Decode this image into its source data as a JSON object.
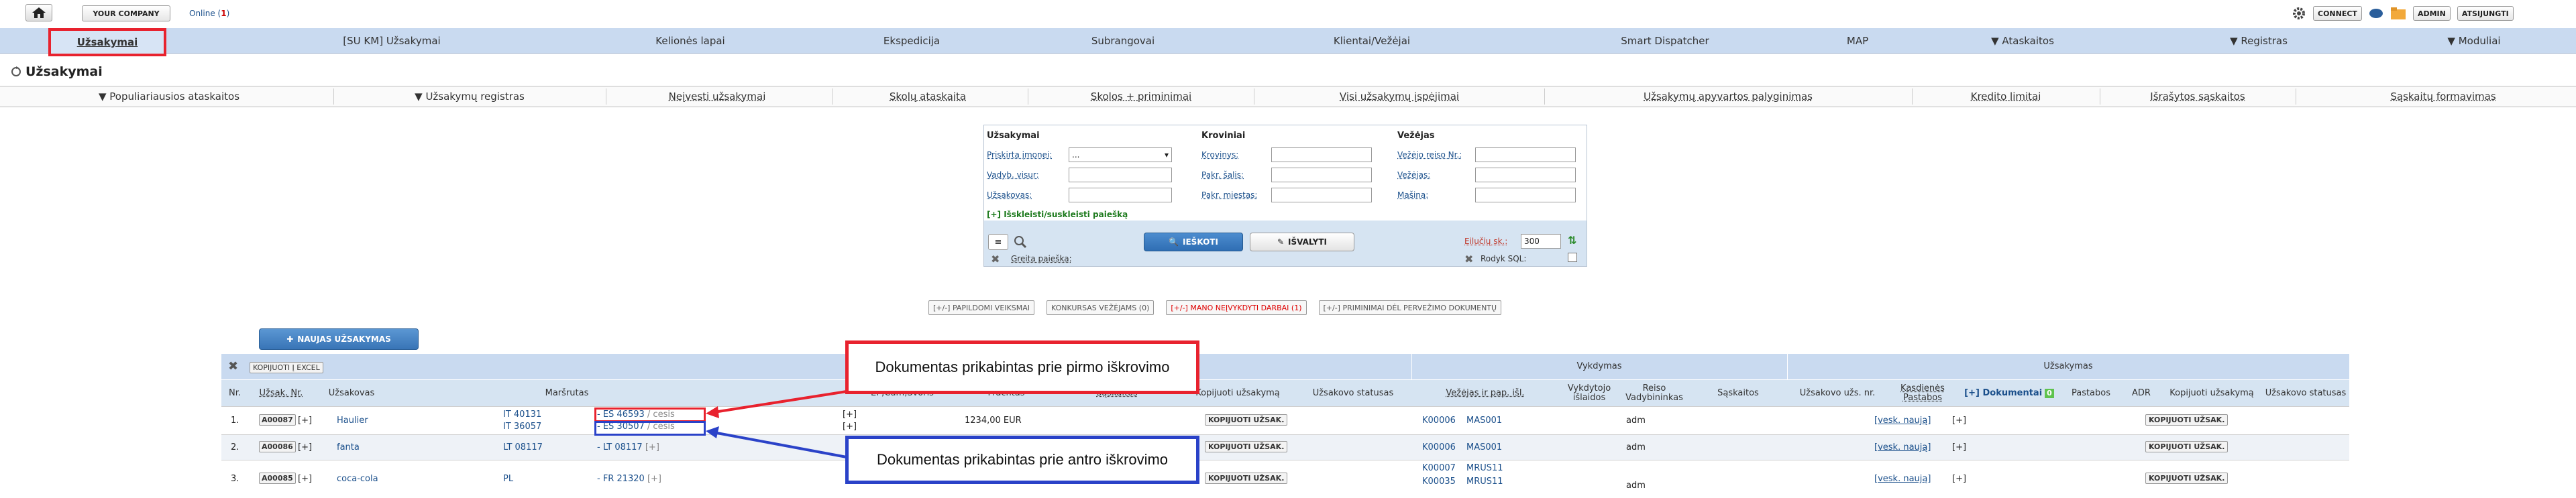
{
  "topbar": {
    "company_label": "YOUR COMPANY",
    "online_label": "Online",
    "online_count": "1",
    "connect_label": "CONNECT",
    "admin_label": "ADMIN",
    "logout_label": "ATSIJUNGTI"
  },
  "nav1": {
    "items": [
      "Užsakymai",
      "[SU KM] Užsakymai",
      "Kelionės lapai",
      "Ekspedicija",
      "Subrangovai",
      "Klientai/Vežėjai",
      "Smart Dispatcher",
      "MAP",
      "▼ Ataskaitos",
      "▼ Registras",
      "▼ Moduliai"
    ]
  },
  "page": {
    "title": "Užsakymai"
  },
  "nav2": {
    "items": [
      "▼ Populiariausios ataskaitos",
      "▼ Užsakymų registras",
      "Neįvesti užsakymai",
      "Skolų ataskaita",
      "Skolos + priminimai",
      "Visi užsakymų įspėjimai",
      "Užsakymų apyvartos palyginimas",
      "Kredito limitai",
      "Išrašytos sąskaitos",
      "Sąskaitų formavimas"
    ]
  },
  "search": {
    "col1_title": "Užsakymai",
    "col1_fields": [
      "Priskirta įmonei:",
      "Vadyb. visur:",
      "Užsakovas:"
    ],
    "select_value": "...",
    "col2_title": "Kroviniai",
    "col2_fields": [
      "Krovinys:",
      "Pakr. šalis:",
      "Pakr. miestas:"
    ],
    "col3_title": "Vežėjas",
    "col3_fields": [
      "Vežėjo reiso Nr.:",
      "Vežėjas:",
      "Mašina:"
    ],
    "expand_label": "[+] Išskleisti/suskleisti paiešką",
    "search_button": "IEŠKOTI",
    "clear_button": "IŠVALYTI",
    "rows_label": "Eilučių sk.:",
    "rows_value": "300",
    "quick_search_label": "Greita paieška:",
    "show_sql_label": "Rodyk SQL:"
  },
  "chips": [
    "[+/-] PAPILDOMI VEIKSMAI",
    "KONKURSAS VEŽĖJAMS (0)",
    "[+/-] MANO NEĮVYKDYTI DARBAI (1)",
    "[+/-] PRIMINIMAI DĖL PERVEŽIMO DOKUMENTŲ"
  ],
  "new_order_button": "NAUJAS UŽSAKYMAS",
  "copy_excel": "KOPIJUOTI Į EXCEL",
  "table": {
    "group_vykdymas": "Vykdymas",
    "group_uzsakymas": "Užsakymas",
    "headers": [
      "Nr.",
      "Užsak. Nr.",
      "Užsakovas",
      "Maršrutas",
      "EP,Cum,Svoris",
      "Frachtas",
      "Sąskaitos",
      "Kopijuoti užsakymą",
      "Užsakovo statusas",
      "Vežėjas ir pap. išl.",
      "Vykdytojo išlaidos",
      "Reiso Vadybininkas",
      "Sąskaitos",
      "Užsakovo užs. nr.",
      "Kasdienės Pastabos",
      "[+] Dokumentai",
      "Pastabos",
      "ADR",
      "Kopijuoti užsakymą",
      "Užsakovo statusas"
    ],
    "docs_badge": "0",
    "rows": [
      {
        "nr": "1.",
        "id": "A00087",
        "plus": "[+]",
        "client": "Haulier",
        "route_a": "IT 40131",
        "route_b": "IT 36057",
        "doc1": "- ES 46593",
        "doc1b": "/ cesis",
        "doc2": "- ES 30507",
        "doc2b": "/ cesis",
        "ep1": "[+]",
        "ep2": "[+]",
        "freight": "1234,00 EUR",
        "copy": "KOPIJUOTI UŽSAK.",
        "carrier_code": "K00006",
        "carrier_name": "MAS001",
        "manager": "adm",
        "daily": "[vesk. naują]",
        "docs": "[+]",
        "copy2": "KOPIJUOTI UŽSAK."
      },
      {
        "nr": "2.",
        "id": "A00086",
        "plus": "[+]",
        "client": "fanta",
        "route_a": "LT 08117",
        "doc1": "- LT 08117",
        "doc1b": "[+]",
        "copy": "KOPIJUOTI UŽSAK.",
        "carrier_code": "K00006",
        "carrier_name": "MAS001",
        "manager": "adm",
        "daily": "[vesk. naują]",
        "docs": "[+]",
        "copy2": "KOPIJUOTI UŽSAK."
      },
      {
        "nr": "3.",
        "id": "A00085",
        "plus": "[+]",
        "client": "coca-cola",
        "route_a": "PL",
        "doc1": "- FR 21320",
        "doc1b": "[+]",
        "copy": "KOPIJUOTI UŽSAK.",
        "carrier_code": "K00007",
        "carrier_name": "MRUS11",
        "carrier_code2": "K00035",
        "carrier_name2": "MRUS11",
        "manager": "adm",
        "daily": "[vesk. naują]",
        "docs": "[+]",
        "copy2": "KOPIJUOTI UŽSAK."
      }
    ]
  },
  "callouts": {
    "first": "Dokumentas prikabintas prie pirmo iškrovimo",
    "second": "Dokumentas prikabintas prie antro iškrovimo"
  },
  "colors": {
    "accent_red": "#e8222e",
    "accent_blue": "#2a42c8",
    "nav_bg": "#c9daf0"
  }
}
